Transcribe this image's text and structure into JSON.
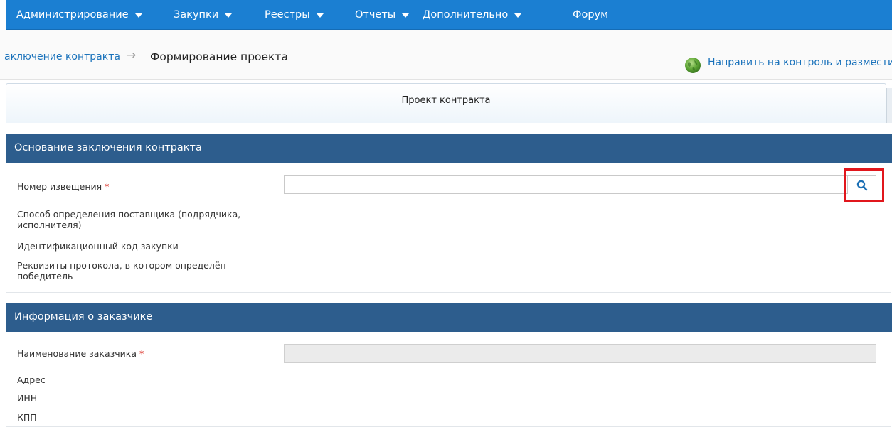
{
  "topnav": {
    "items": [
      {
        "label": "Администрирование",
        "has_dropdown": true
      },
      {
        "label": "Закупки",
        "has_dropdown": true
      },
      {
        "label": "Реестры",
        "has_dropdown": true
      },
      {
        "label": "Отчеты",
        "has_dropdown": true
      },
      {
        "label": "Дополнительно",
        "has_dropdown": true
      },
      {
        "label": "Форум",
        "has_dropdown": false
      }
    ]
  },
  "breadcrumb": {
    "parent": "аключение контракта",
    "separator": "→",
    "current": "Формирование проекта"
  },
  "actions": {
    "send_to_control": "Направить на контроль и разместить"
  },
  "tab": {
    "title": "Проект контракта"
  },
  "sections": {
    "basis": {
      "title": "Основание заключения контракта",
      "fields": {
        "notice_number": {
          "label": "Номер извещения",
          "required": "*",
          "value": ""
        },
        "supplier_method": {
          "label_line1": "Способ определения поставщика (подрядчика,",
          "label_line2": "исполнителя)"
        },
        "purchase_code": {
          "label": "Идентификационный код закупки"
        },
        "protocol": {
          "label_line1": "Реквизиты протокола, в котором определён",
          "label_line2": "победитель"
        }
      }
    },
    "customer": {
      "title": "Информация о заказчике",
      "fields": {
        "name": {
          "label": "Наименование заказчика",
          "required": "*",
          "value": ""
        },
        "address": {
          "label": "Адрес"
        },
        "inn": {
          "label": "ИНН"
        },
        "kpp": {
          "label": "КПП"
        }
      }
    }
  },
  "icons": {
    "search": "search-icon",
    "globe": "globe-icon",
    "dropdown": "caret-down-icon"
  },
  "colors": {
    "topnav_bg": "#1b7fd2",
    "section_header_bg": "#2d5d8d",
    "link": "#1a72bb",
    "highlight_border": "#e1161c",
    "required_mark": "#d9261c"
  }
}
